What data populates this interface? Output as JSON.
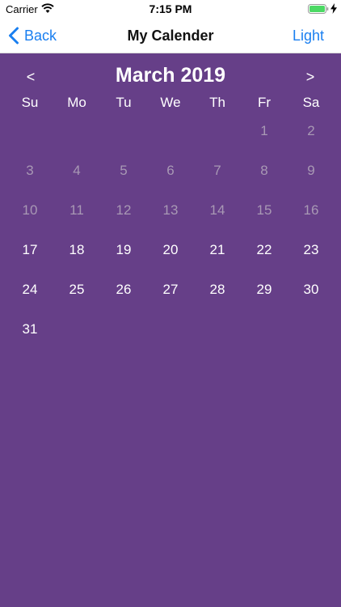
{
  "status_bar": {
    "carrier": "Carrier",
    "time": "7:15 PM"
  },
  "nav": {
    "back_label": "Back",
    "title": "My Calender",
    "right_label": "Light"
  },
  "calendar": {
    "prev_label": "<",
    "next_label": ">",
    "month_title": "March 2019",
    "weekdays": [
      "Su",
      "Mo",
      "Tu",
      "We",
      "Th",
      "Fr",
      "Sa"
    ],
    "leading_blanks": 5,
    "days": [
      {
        "d": "1",
        "past": true
      },
      {
        "d": "2",
        "past": true
      },
      {
        "d": "3",
        "past": true
      },
      {
        "d": "4",
        "past": true
      },
      {
        "d": "5",
        "past": true
      },
      {
        "d": "6",
        "past": true
      },
      {
        "d": "7",
        "past": true
      },
      {
        "d": "8",
        "past": true
      },
      {
        "d": "9",
        "past": true
      },
      {
        "d": "10",
        "past": true
      },
      {
        "d": "11",
        "past": true
      },
      {
        "d": "12",
        "past": true
      },
      {
        "d": "13",
        "past": true
      },
      {
        "d": "14",
        "past": true
      },
      {
        "d": "15",
        "past": true
      },
      {
        "d": "16",
        "past": true
      },
      {
        "d": "17",
        "past": false
      },
      {
        "d": "18",
        "past": false
      },
      {
        "d": "19",
        "past": false
      },
      {
        "d": "20",
        "past": false
      },
      {
        "d": "21",
        "past": false
      },
      {
        "d": "22",
        "past": false
      },
      {
        "d": "23",
        "past": false
      },
      {
        "d": "24",
        "past": false
      },
      {
        "d": "25",
        "past": false
      },
      {
        "d": "26",
        "past": false
      },
      {
        "d": "27",
        "past": false
      },
      {
        "d": "28",
        "past": false
      },
      {
        "d": "29",
        "past": false
      },
      {
        "d": "30",
        "past": false
      },
      {
        "d": "31",
        "past": false
      }
    ]
  },
  "colors": {
    "background": "#663f88",
    "accent": "#1a7ff0",
    "past_day": "#a898b4"
  },
  "icons": {
    "back": "chevron-left-icon",
    "wifi": "wifi-icon",
    "battery": "battery-icon",
    "charging": "charging-bolt-icon"
  }
}
